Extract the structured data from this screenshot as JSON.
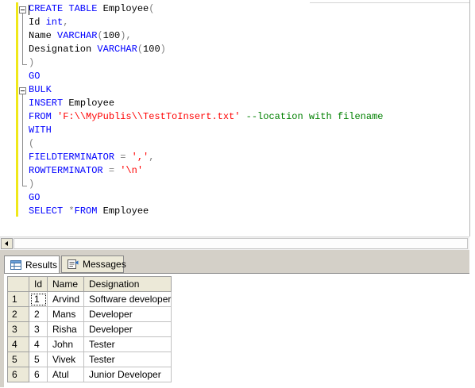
{
  "editor": {
    "code_lines": [
      [
        {
          "t": "CREATE TABLE",
          "c": "kw"
        },
        {
          "t": " Employee",
          "c": ""
        },
        {
          "t": "(",
          "c": "op"
        }
      ],
      [
        {
          "t": "Id ",
          "c": ""
        },
        {
          "t": "int",
          "c": "kw"
        },
        {
          "t": ",",
          "c": "op"
        }
      ],
      [
        {
          "t": "Name ",
          "c": ""
        },
        {
          "t": "VARCHAR",
          "c": "kw"
        },
        {
          "t": "(",
          "c": "op"
        },
        {
          "t": "100",
          "c": ""
        },
        {
          "t": "),",
          "c": "op"
        }
      ],
      [
        {
          "t": "Designation ",
          "c": ""
        },
        {
          "t": "VARCHAR",
          "c": "kw"
        },
        {
          "t": "(",
          "c": "op"
        },
        {
          "t": "100",
          "c": ""
        },
        {
          "t": ")",
          "c": "op"
        }
      ],
      [
        {
          "t": ")",
          "c": "op"
        }
      ],
      [
        {
          "t": "GO",
          "c": "kw"
        }
      ],
      [
        {
          "t": "BULK",
          "c": "kw"
        }
      ],
      [
        {
          "t": "INSERT",
          "c": "kw"
        },
        {
          "t": " Employee",
          "c": ""
        }
      ],
      [
        {
          "t": "FROM ",
          "c": "kw"
        },
        {
          "t": "'F:\\\\MyPublis\\\\TestToInsert.txt'",
          "c": "str"
        },
        {
          "t": " --location with filename",
          "c": "cmt"
        }
      ],
      [
        {
          "t": "WITH",
          "c": "kw"
        }
      ],
      [
        {
          "t": "(",
          "c": "op"
        }
      ],
      [
        {
          "t": "FIELDTERMINATOR ",
          "c": "kw"
        },
        {
          "t": "=",
          "c": "op"
        },
        {
          "t": " ','",
          "c": "str"
        },
        {
          "t": ",",
          "c": "op"
        }
      ],
      [
        {
          "t": "ROWTERMINATOR ",
          "c": "kw"
        },
        {
          "t": "=",
          "c": "op"
        },
        {
          "t": " '\\n'",
          "c": "str"
        }
      ],
      [
        {
          "t": ")",
          "c": "op"
        }
      ],
      [
        {
          "t": "GO",
          "c": "kw"
        }
      ],
      [
        {
          "t": "SELECT ",
          "c": "kw"
        },
        {
          "t": "*",
          "c": "op"
        },
        {
          "t": "FROM",
          "c": "kw"
        },
        {
          "t": " Employee",
          "c": ""
        }
      ]
    ]
  },
  "tabs": {
    "results_label": "Results",
    "messages_label": "Messages",
    "results_icon": "grid-icon",
    "messages_icon": "messages-icon"
  },
  "grid": {
    "columns": [
      "Id",
      "Name",
      "Designation"
    ],
    "rows": [
      {
        "row": "1",
        "id": "1",
        "name": "Arvind",
        "designation": "Software developer"
      },
      {
        "row": "2",
        "id": "2",
        "name": "Mans",
        "designation": "Developer"
      },
      {
        "row": "3",
        "id": "3",
        "name": "Risha",
        "designation": "Developer"
      },
      {
        "row": "4",
        "id": "4",
        "name": "John",
        "designation": "Tester"
      },
      {
        "row": "5",
        "id": "5",
        "name": "Vivek",
        "designation": "Tester"
      },
      {
        "row": "6",
        "id": "6",
        "name": "Atul",
        "designation": "Junior Developer"
      }
    ]
  },
  "colors": {
    "keyword": "#0000ff",
    "string": "#ff0000",
    "comment": "#008000",
    "operator": "#808080",
    "change_bar": "#f0e81a"
  }
}
